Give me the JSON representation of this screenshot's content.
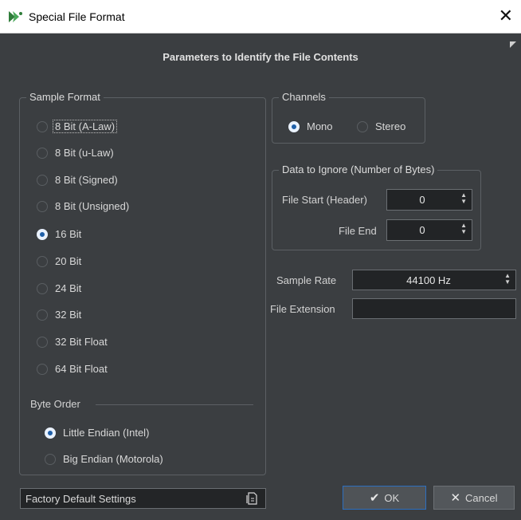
{
  "window": {
    "title": "Special File Format",
    "close_glyph": "✕"
  },
  "heading": "Parameters to Identify the File Contents",
  "sample_format": {
    "label": "Sample Format",
    "options": [
      {
        "label": "8 Bit (A-Law)",
        "selected": false
      },
      {
        "label": "8 Bit (u-Law)",
        "selected": false
      },
      {
        "label": "8 Bit (Signed)",
        "selected": false
      },
      {
        "label": "8 Bit (Unsigned)",
        "selected": false
      },
      {
        "label": "16 Bit",
        "selected": true
      },
      {
        "label": "20 Bit",
        "selected": false
      },
      {
        "label": "24 Bit",
        "selected": false
      },
      {
        "label": "32 Bit",
        "selected": false
      },
      {
        "label": "32 Bit Float",
        "selected": false
      },
      {
        "label": "64 Bit Float",
        "selected": false
      }
    ]
  },
  "byte_order": {
    "label": "Byte Order",
    "options": [
      {
        "label": "Little Endian (Intel)",
        "selected": true
      },
      {
        "label": "Big Endian (Motorola)",
        "selected": false
      }
    ]
  },
  "channels": {
    "label": "Channels",
    "options": [
      {
        "label": "Mono",
        "selected": true
      },
      {
        "label": "Stereo",
        "selected": false
      }
    ]
  },
  "data_to_ignore": {
    "label": "Data to Ignore (Number of Bytes)",
    "file_start_label": "File Start (Header)",
    "file_start_value": "0",
    "file_end_label": "File End",
    "file_end_value": "0"
  },
  "sample_rate": {
    "label": "Sample Rate",
    "value": "44100 Hz"
  },
  "file_extension": {
    "label": "File Extension",
    "value": ""
  },
  "buttons": {
    "factory": "Factory Default Settings",
    "ok": "OK",
    "cancel": "Cancel"
  },
  "colors": {
    "accent": "#2d6fbf",
    "background": "#3b3e41",
    "field": "#222426"
  },
  "icons": [
    "app-logo-icon",
    "close-icon",
    "resize-grip-icon",
    "document-icon",
    "checkmark-icon",
    "x-icon"
  ]
}
